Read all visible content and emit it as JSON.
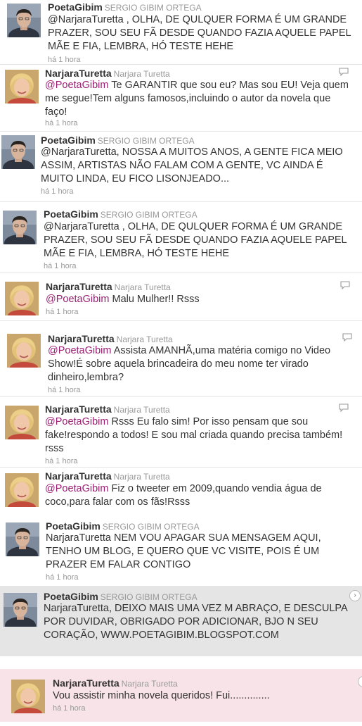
{
  "time_label": "há 1 hora",
  "tweets": [
    {
      "screen_name": "PoetaGibim",
      "full_name": "SERGIO GIBIM ORTEGA",
      "mention": "",
      "text": "@NarjaraTuretta , OLHA, DE QULQUER FORMA É UM GRANDE PRAZER, SOU SEU FÃ DESDE QUANDO FAZIA AQUELE PAPEL MÃE E FIA, LEMBRA, HÓ TESTE HEHE",
      "avatar": "man-avatar"
    },
    {
      "screen_name": "NarjaraTuretta",
      "full_name": "Narjara Turetta",
      "mention": "@PoetaGibim",
      "text": " Te GARANTIR que sou eu? Mas sou EU! Veja quem me segue!Tem alguns famosos,incluindo o autor da novela que faço!",
      "avatar": "woman-avatar"
    },
    {
      "screen_name": "PoetaGibim",
      "full_name": "SERGIO GIBIM ORTEGA",
      "mention": "",
      "text": "@NarjaraTuretta, NOSSA A MUITOS ANOS, A GENTE FICA MEIO ASSIM, ARTISTAS NÃO FALAM COM A GENTE, VC AINDA É MUITO LINDA, EU FICO LISONJEADO...",
      "avatar": "man-avatar"
    },
    {
      "screen_name": "PoetaGibim",
      "full_name": "SERGIO GIBIM ORTEGA",
      "mention": "",
      "text": "@NarjaraTuretta , OLHA, DE QULQUER FORMA É UM GRANDE PRAZER, SOU SEU FÃ DESDE QUANDO FAZIA AQUELE PAPEL MÃE E FIA, LEMBRA, HÓ TESTE HEHE",
      "avatar": "man-avatar"
    },
    {
      "screen_name": "NarjaraTuretta",
      "full_name": "Narjara Turetta",
      "mention": "@PoetaGibim",
      "text": " Malu Mulher!! Rsss",
      "avatar": "woman-avatar"
    },
    {
      "screen_name": "NarjaraTuretta",
      "full_name": "Narjara Turetta",
      "mention": "@PoetaGibim",
      "text": " Assista AMANHÃ,uma matéria comigo no Video Show!É sobre aquela brincadeira do meu nome ter virado dinheiro,lembra?",
      "avatar": "woman-avatar"
    },
    {
      "screen_name": "NarjaraTuretta",
      "full_name": "Narjara Turetta",
      "mention": "@PoetaGibim",
      "text": " Rsss Eu falo sim! Por isso pensam que sou fake!respondo a todos! E sou mal criada quando precisa também! rsss",
      "avatar": "woman-avatar"
    },
    {
      "screen_name": "NarjaraTuretta",
      "full_name": "Narjara Turetta",
      "mention": "@PoetaGibim",
      "text": " Fiz o tweeter em 2009,quando vendia água de coco,para falar com os fãs!Rsss",
      "avatar": "woman-avatar"
    },
    {
      "screen_name": "PoetaGibim",
      "full_name": "SERGIO GIBIM ORTEGA",
      "mention": "",
      "text": "NarjaraTuretta NEM VOU APAGAR SUA MENSAGEM AQUI, TENHO UM BLOG, E QUERO QUE VC VISITE, POIS É UM PRAZER EM FALAR CONTIGO",
      "avatar": "man-avatar"
    },
    {
      "screen_name": "PoetaGibim",
      "full_name": "SERGIO GIBIM ORTEGA",
      "mention": "",
      "text": "NarjaraTuretta, DEIXO MAIS UMA VEZ M ABRAÇO, E DESCULPA POR DUVIDAR, OBRIGADO POR ADICIONAR, BJO N SEU CORAÇÃO, WWW.POETAGIBIM.BLOGSPOT.COM",
      "avatar": "man-avatar"
    },
    {
      "screen_name": "NarjaraTuretta",
      "full_name": "Narjara Turetta",
      "mention": "",
      "text": "Vou assistir minha novela queridos! Fui..............",
      "avatar": "woman-avatar"
    }
  ],
  "colors": {
    "mention": "#9a1e72",
    "highlight_gray": "#e5e5e5",
    "highlight_pink": "#f8e3e8"
  }
}
